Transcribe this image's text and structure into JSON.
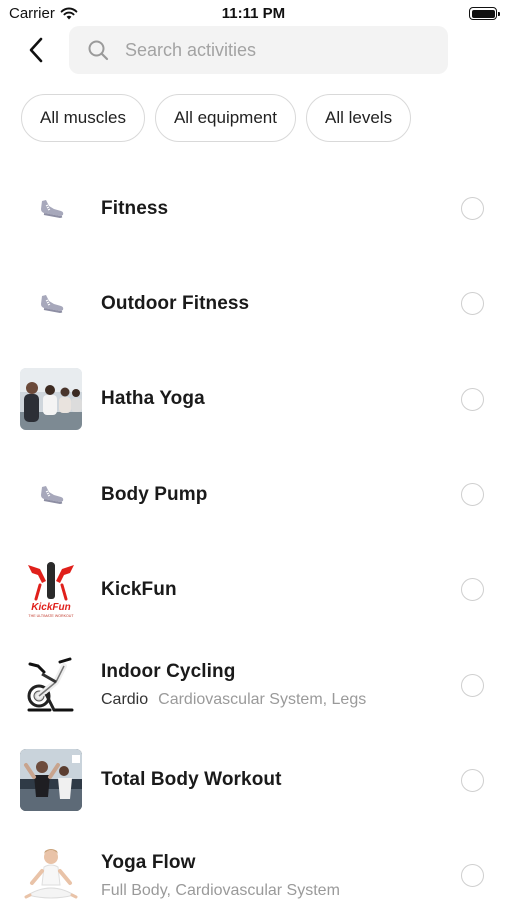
{
  "status_bar": {
    "carrier": "Carrier",
    "time": "11:11 PM"
  },
  "search": {
    "placeholder": "Search activities"
  },
  "filters": [
    {
      "label": "All muscles"
    },
    {
      "label": "All equipment"
    },
    {
      "label": "All levels"
    }
  ],
  "activities": [
    {
      "title": "Fitness",
      "category": "",
      "muscles": "",
      "icon": "sneaker-icon",
      "selected": false
    },
    {
      "title": "Outdoor Fitness",
      "category": "",
      "muscles": "",
      "icon": "sneaker-icon",
      "selected": false
    },
    {
      "title": "Hatha Yoga",
      "category": "",
      "muscles": "",
      "icon": "yoga-class-photo",
      "selected": false
    },
    {
      "title": "Body Pump",
      "category": "",
      "muscles": "",
      "icon": "sneaker-icon",
      "selected": false
    },
    {
      "title": "KickFun",
      "category": "",
      "muscles": "",
      "icon": "kickfun-logo",
      "logo_text": "KickFun",
      "logo_tagline": "THE ULTIMATE WORKOUT",
      "selected": false
    },
    {
      "title": "Indoor Cycling",
      "category": "Cardio",
      "muscles": "Cardiovascular System, Legs",
      "icon": "stationary-bike-icon",
      "selected": false
    },
    {
      "title": "Total Body Workout",
      "category": "",
      "muscles": "",
      "icon": "gym-workout-photo",
      "selected": false
    },
    {
      "title": "Yoga Flow",
      "category": "",
      "muscles": "Full Body, Cardiovascular System",
      "icon": "meditation-figure-icon",
      "selected": false
    }
  ],
  "colors": {
    "accent_sneaker": "#9a9bb0",
    "kickfun_red": "#e0201b"
  }
}
